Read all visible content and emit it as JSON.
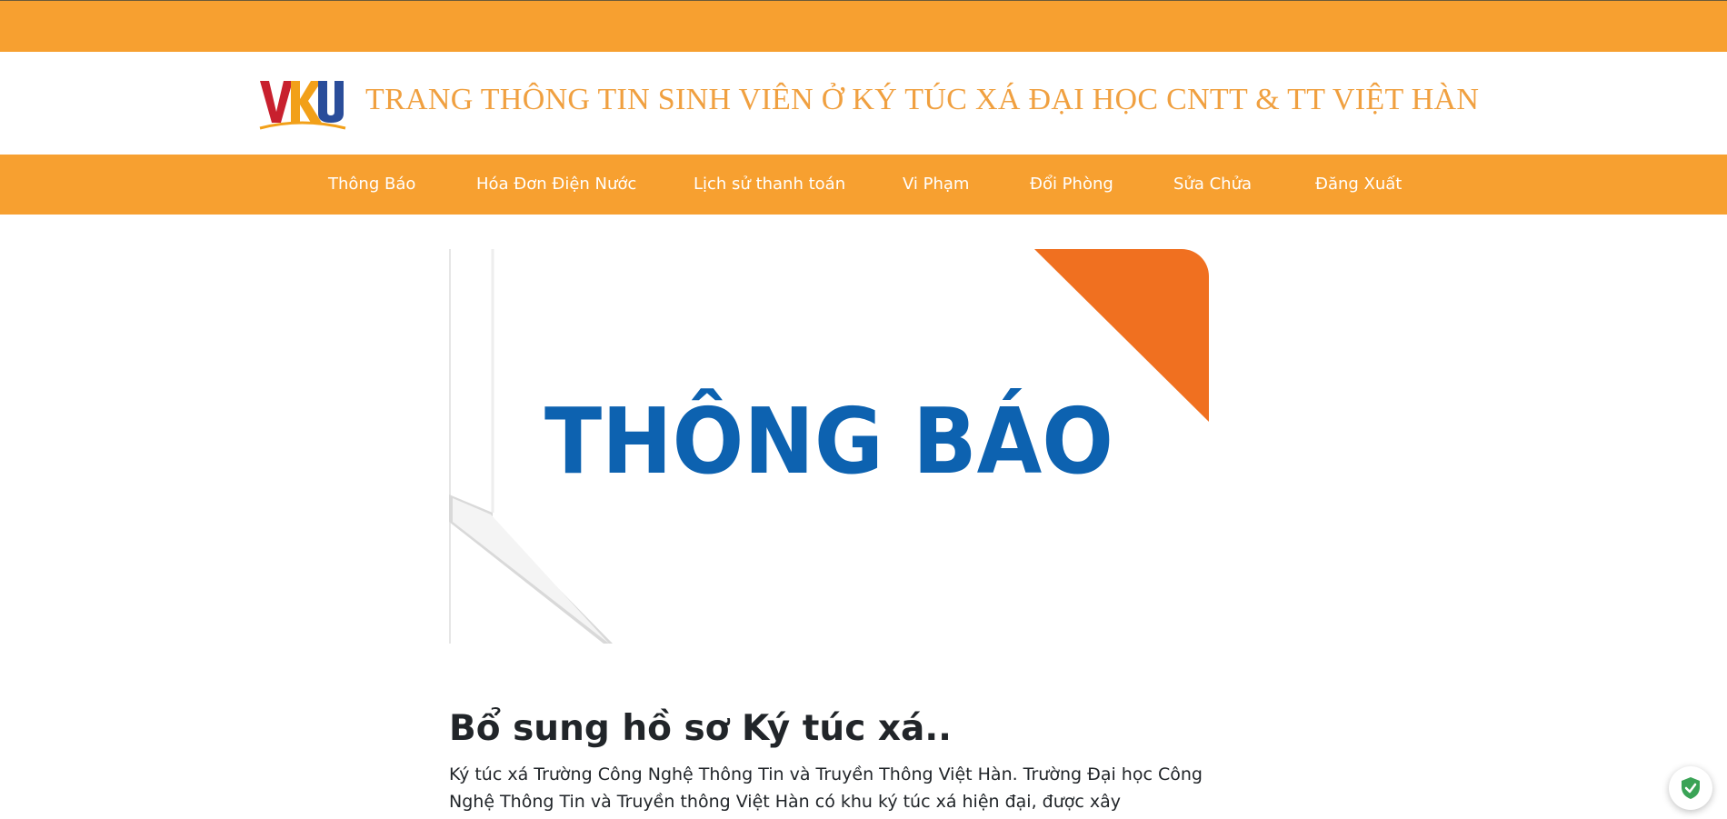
{
  "header": {
    "logo_text": "VKU",
    "site_title": "TRANG THÔNG TIN SINH VIÊN Ở KÝ TÚC XÁ ĐẠI HỌC CNTT & TT VIỆT HÀN"
  },
  "nav": {
    "items": [
      {
        "label": "Thông Báo"
      },
      {
        "label": "Hóa Đơn Điện Nước"
      },
      {
        "label": "Lịch sử thanh toán"
      },
      {
        "label": "Vi Phạm"
      },
      {
        "label": "Đổi Phòng"
      },
      {
        "label": "Sửa Chửa"
      },
      {
        "label": "Đăng Xuất"
      }
    ]
  },
  "banner": {
    "text": "THÔNG BÁO"
  },
  "post": {
    "title": "Bổ sung hồ sơ Ký túc xá..",
    "body": "Ký túc xá Trường Công Nghệ Thông Tin và Truyền Thông Việt Hàn. Trường Đại học Công Nghệ Thông Tin và Truyền thông Việt Hàn có khu ký túc xá hiện đại, được xây"
  },
  "colors": {
    "accent": "#f7a030",
    "title_orange": "#f0a040",
    "banner_blue": "#0d62b0",
    "banner_corner": "#f07020",
    "shield_green": "#3aa356"
  },
  "icons": {
    "security_badge": "shield-check-icon"
  }
}
